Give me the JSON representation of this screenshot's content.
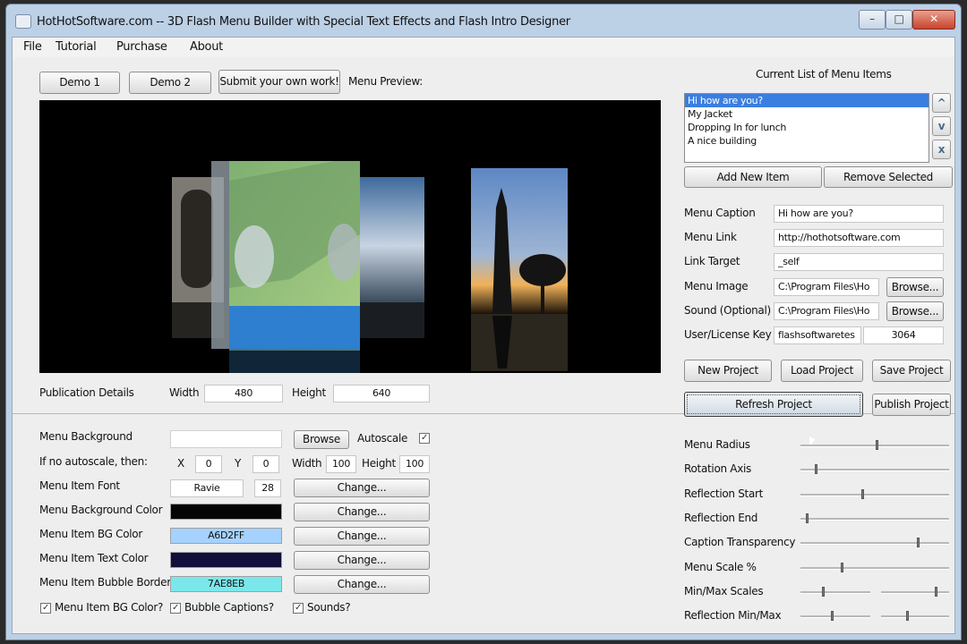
{
  "window": {
    "title": "HotHotSoftware.com -- 3D Flash Menu Builder with Special Text Effects and Flash Intro Designer"
  },
  "menu": {
    "file": "File",
    "tutorial": "Tutorial",
    "purchase": "Purchase",
    "about": "About"
  },
  "top_buttons": {
    "demo1": "Demo 1",
    "demo2": "Demo 2",
    "submit": "Submit your own work!",
    "preview_label": "Menu Preview:"
  },
  "items_panel": {
    "title": "Current List of Menu Items",
    "items": [
      "Hi how are you?",
      "My Jacket",
      "Dropping In for lunch",
      "A nice building"
    ],
    "up": "^",
    "down": "v",
    "remove_x": "x",
    "add_label": "Add New Item",
    "remove_label": "Remove Selected"
  },
  "fields": {
    "caption_label": "Menu Caption",
    "caption_value": "Hi how are you?",
    "link_label": "Menu Link",
    "link_value": "http://hothotsoftware.com",
    "target_label": "Link Target",
    "target_value": "_self",
    "image_label": "Menu Image",
    "image_value": "C:\\Program Files\\Ho",
    "sound_label": "Sound (Optional)",
    "sound_value": "C:\\Program Files\\Ho",
    "browse": "Browse...",
    "license_label": "User/License Key",
    "license_user": "flashsoftwaretes",
    "license_key": "3064"
  },
  "project": {
    "new": "New Project",
    "load": "Load Project",
    "save": "Save Project",
    "refresh": "Refresh Project",
    "publish": "Publish Project"
  },
  "publication": {
    "label": "Publication Details",
    "width_label": "Width",
    "width_value": "480",
    "height_label": "Height",
    "height_value": "640"
  },
  "settings": {
    "bg_label": "Menu Background",
    "bg_browse": "Browse",
    "autoscale_label": "Autoscale",
    "noauto_label": "If no autoscale, then:",
    "x_label": "X",
    "x_value": "0",
    "y_label": "Y",
    "y_value": "0",
    "w_label": "Width",
    "w_value": "100",
    "h_label": "Height",
    "h_value": "100",
    "font_label": "Menu Item Font",
    "font_value": "Ravie",
    "font_size": "28",
    "change": "Change...",
    "bgcolor_label": "Menu Background Color",
    "itembg_label": "Menu Item BG Color",
    "itembg_value": "A6D2FF",
    "text_color_label": "Menu Item Text Color",
    "bubble_label": "Menu Item Bubble Border",
    "bubble_value": "7AE8EB",
    "chk_itembg": "Menu Item BG Color?",
    "chk_bubble": "Bubble Captions?",
    "chk_sounds": "Sounds?"
  },
  "colors": {
    "menu_bg": "#050505",
    "item_bg": "#A6D2FF",
    "text_color": "#120f3a",
    "bubble": "#7AE8EB"
  },
  "sliders": {
    "radius": "Menu Radius",
    "rotation": "Rotation Axis",
    "refl_start": "Reflection Start",
    "refl_end": "Reflection End",
    "caption_transp": "Caption Transparency",
    "scale": "Menu Scale %",
    "minmax_scales": "Min/Max Scales",
    "refl_minmax": "Reflection Min/Max"
  },
  "slider_values": {
    "radius": 0.52,
    "rotation": 0.1,
    "refl_start": 0.42,
    "refl_end": 0.04,
    "caption_transp": 0.8,
    "scale": 0.28
  }
}
